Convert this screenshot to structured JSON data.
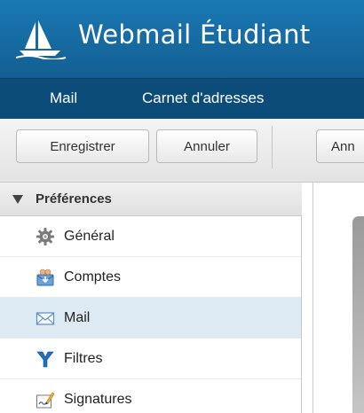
{
  "header": {
    "title": "Webmail Étudiant",
    "logo_icon": "sailboat-logo-icon"
  },
  "topnav": {
    "items": [
      {
        "label": "Mail"
      },
      {
        "label": "Carnet d'adresses"
      }
    ]
  },
  "toolbar": {
    "save_label": "Enregistrer",
    "cancel_label": "Annuler",
    "cut_label": "Ann"
  },
  "sidebar": {
    "section_title": "Préférences",
    "items": [
      {
        "label": "Général",
        "icon": "gear-icon"
      },
      {
        "label": "Comptes",
        "icon": "accounts-icon"
      },
      {
        "label": "Mail",
        "icon": "envelope-icon"
      },
      {
        "label": "Filtres",
        "icon": "filter-icon"
      },
      {
        "label": "Signatures",
        "icon": "signature-icon"
      }
    ],
    "selected": "Mail"
  },
  "colors": {
    "header_blue": "#1a78b4",
    "nav_blue": "#0b4d78",
    "selected_row": "#dde9f3"
  }
}
